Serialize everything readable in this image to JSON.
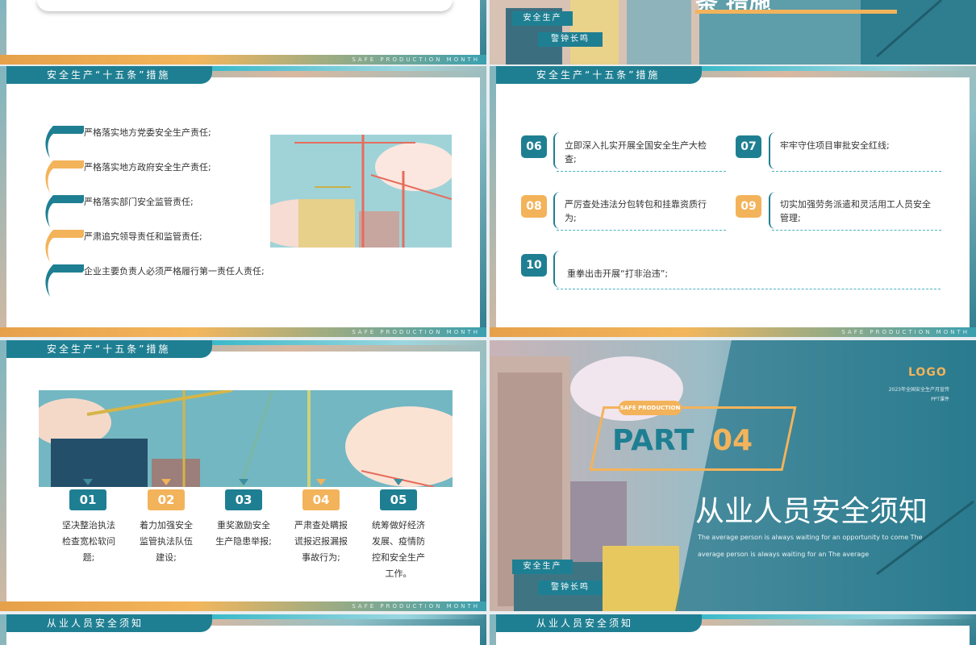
{
  "top_left": {
    "footer": "SAFE PRODUCTION MONTH"
  },
  "top_right": {
    "heading_fragment": "条  措施",
    "tag1": "安全生产",
    "tag2": "警钟长鸣"
  },
  "slide_a": {
    "tab": "安全生产“十五条”措施",
    "bullets": [
      "严格落实地方党委安全生产责任;",
      "严格落实地方政府安全生产责任;",
      "严格落实部门安全监管责任;",
      "严肃追究领导责任和监管责任;",
      "企业主要负责人必须严格履行第一责任人责任;"
    ],
    "footer": "SAFE PRODUCTION MONTH"
  },
  "slide_b": {
    "tab": "安全生产“十五条”措施",
    "items": [
      {
        "num": "06",
        "text": "立即深入扎实开展全国安全生产大检查;"
      },
      {
        "num": "07",
        "text": "牢牢守住项目审批安全红线;"
      },
      {
        "num": "08",
        "text": "严厉查处违法分包转包和挂靠资质行为;"
      },
      {
        "num": "09",
        "text": "切实加强劳务派遣和灵活用工人员安全管理;"
      },
      {
        "num": "10",
        "text": "重拳出击开展“打非治违”;"
      }
    ],
    "footer": "SAFE PRODUCTION MONTH"
  },
  "slide_c": {
    "tab": "安全生产“十五条”措施",
    "steps": [
      {
        "num": "01",
        "text": "坚决整治执法检查宽松软问题;"
      },
      {
        "num": "02",
        "text": "着力加强安全监管执法队伍建设;"
      },
      {
        "num": "03",
        "text": "重奖激励安全生产隐患举报;"
      },
      {
        "num": "04",
        "text": "严肃查处瞒报谎报迟报漏报事故行为;"
      },
      {
        "num": "05",
        "text": "统筹做好经济发展、疫情防控和安全生产工作。"
      }
    ],
    "footer": "SAFE PRODUCTION MONTH"
  },
  "slide_d": {
    "logo": "LOGO",
    "meta1": "2023年全国安全生产月宣传",
    "meta2": "PPT课件",
    "badge": "SAFE PRODUCTION",
    "part_word": "PART",
    "part_num": "04",
    "title": "从业人员安全须知",
    "sub1": "The average person is always waiting for an opportunity to come The",
    "sub2": "average person is always waiting for an The average",
    "tag1": "安全生产",
    "tag2": "警钟长鸣"
  },
  "bottom_left": {
    "tab": "从业人员安全须知"
  },
  "bottom_right": {
    "tab": "从业人员安全须知"
  },
  "colors": {
    "teal": "#1f7f92",
    "orange": "#f3b35a"
  }
}
